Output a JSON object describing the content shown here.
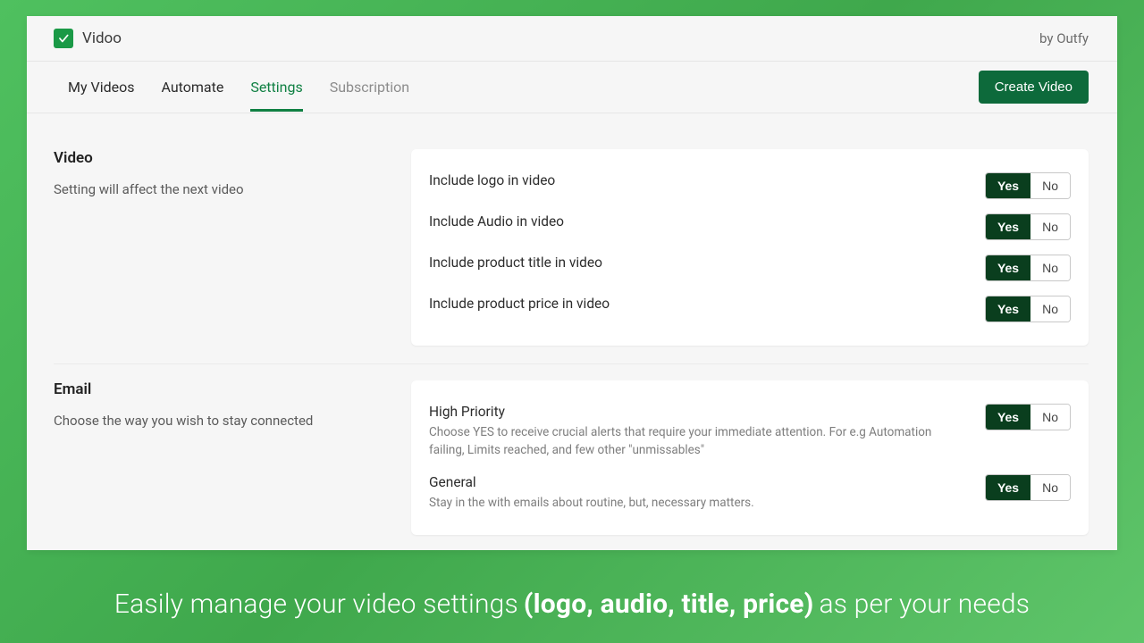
{
  "brand": {
    "name": "Vidoo",
    "by": "by Outfy"
  },
  "tabs": [
    {
      "label": "My Videos",
      "kind": "normal"
    },
    {
      "label": "Automate",
      "kind": "normal"
    },
    {
      "label": "Settings",
      "kind": "active"
    },
    {
      "label": "Subscription",
      "kind": "dim"
    }
  ],
  "create_button": "Create Video",
  "sections": {
    "video": {
      "title": "Video",
      "desc": "Setting will affect the next video",
      "rows": [
        {
          "label": "Include logo in video",
          "yes": "Yes",
          "no": "No"
        },
        {
          "label": "Include Audio in video",
          "yes": "Yes",
          "no": "No"
        },
        {
          "label": "Include product title in video",
          "yes": "Yes",
          "no": "No"
        },
        {
          "label": "Include product price in video",
          "yes": "Yes",
          "no": "No"
        }
      ]
    },
    "email": {
      "title": "Email",
      "desc": "Choose the way you wish to stay connected",
      "rows": [
        {
          "label": "High Priority",
          "help": "Choose YES to receive crucial alerts that require your immediate attention. For e.g Automation failing, Limits reached, and few other \"unmissables\"",
          "yes": "Yes",
          "no": "No"
        },
        {
          "label": "General",
          "help": "Stay in the with emails about routine, but, necessary matters.",
          "yes": "Yes",
          "no": "No"
        }
      ]
    }
  },
  "caption": {
    "pre": "Easily manage your video settings",
    "bold": "(logo, audio, title, price)",
    "post": "as per your needs"
  }
}
